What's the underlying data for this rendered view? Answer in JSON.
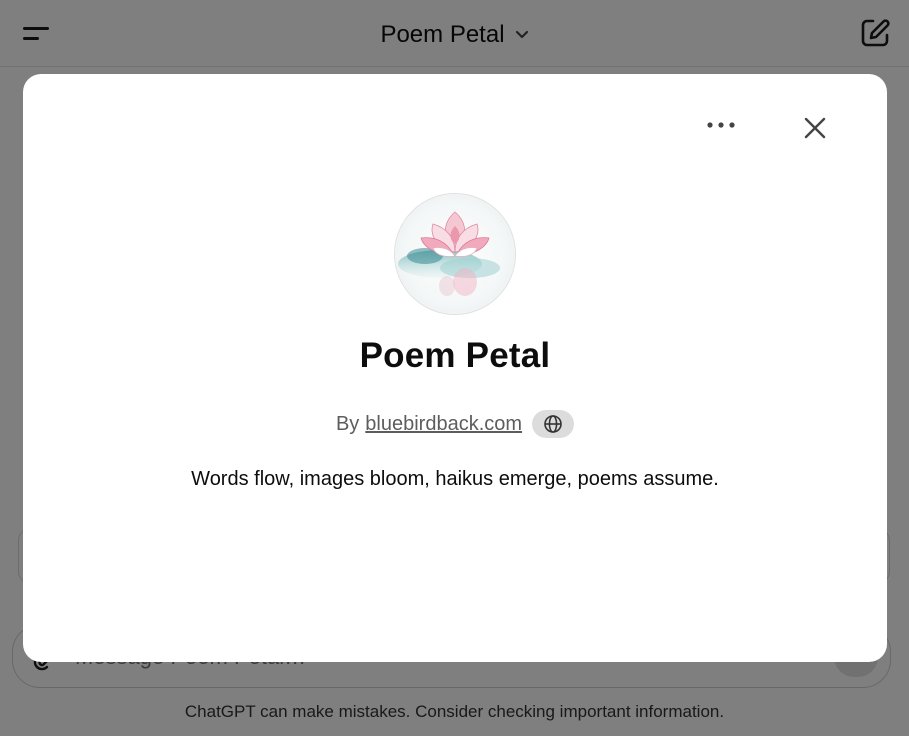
{
  "header": {
    "title": "Poem Petal",
    "menu_icon": "hamburger-icon",
    "dropdown_icon": "chevron-down-icon",
    "new_chat_icon": "edit-icon"
  },
  "composer": {
    "placeholder": "Message Poem Petal…",
    "attach_icon": "paperclip-icon",
    "send_icon": "send-icon"
  },
  "footer": {
    "note": "ChatGPT can make mistakes. Consider checking important information."
  },
  "modal": {
    "title": "Poem Petal",
    "by_prefix": "By",
    "author": "bluebirdback.com",
    "author_badge_icon": "globe-icon",
    "description": "Words flow, images bloom, haikus emerge, poems assume.",
    "more_icon": "ellipsis-icon",
    "close_icon": "close-icon",
    "avatar_icon": "lotus-image"
  },
  "colors": {
    "overlay": "#808080",
    "modal_bg": "#ffffff",
    "text_primary": "#0d0d0d",
    "text_secondary": "#5d5d5d",
    "badge_bg": "#dcdcdc"
  }
}
